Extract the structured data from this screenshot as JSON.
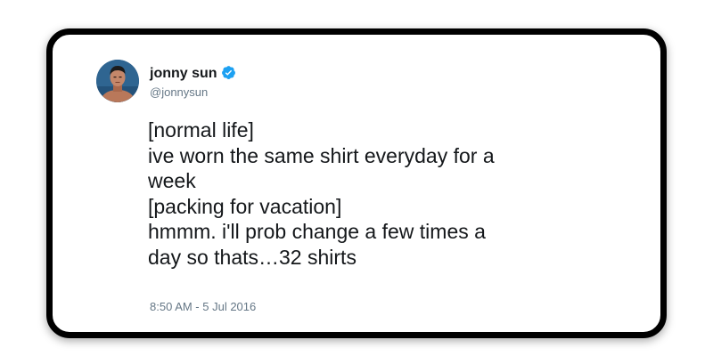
{
  "tweet": {
    "author_name": "jonny sun",
    "handle": "@jonnysun",
    "verified_icon": "verified-badge-icon",
    "lines": [
      "[normal life]",
      "ive worn the same shirt everyday for a",
      "week",
      "[packing for vacation]",
      "hmmm. i'll prob change a few times a",
      "day so thats…32 shirts"
    ],
    "timestamp": "8:50 AM - 5 Jul 2016"
  },
  "colors": {
    "verified_blue": "#1da1f2",
    "text_primary": "#14171a",
    "text_secondary": "#657786",
    "frame": "#000000"
  }
}
